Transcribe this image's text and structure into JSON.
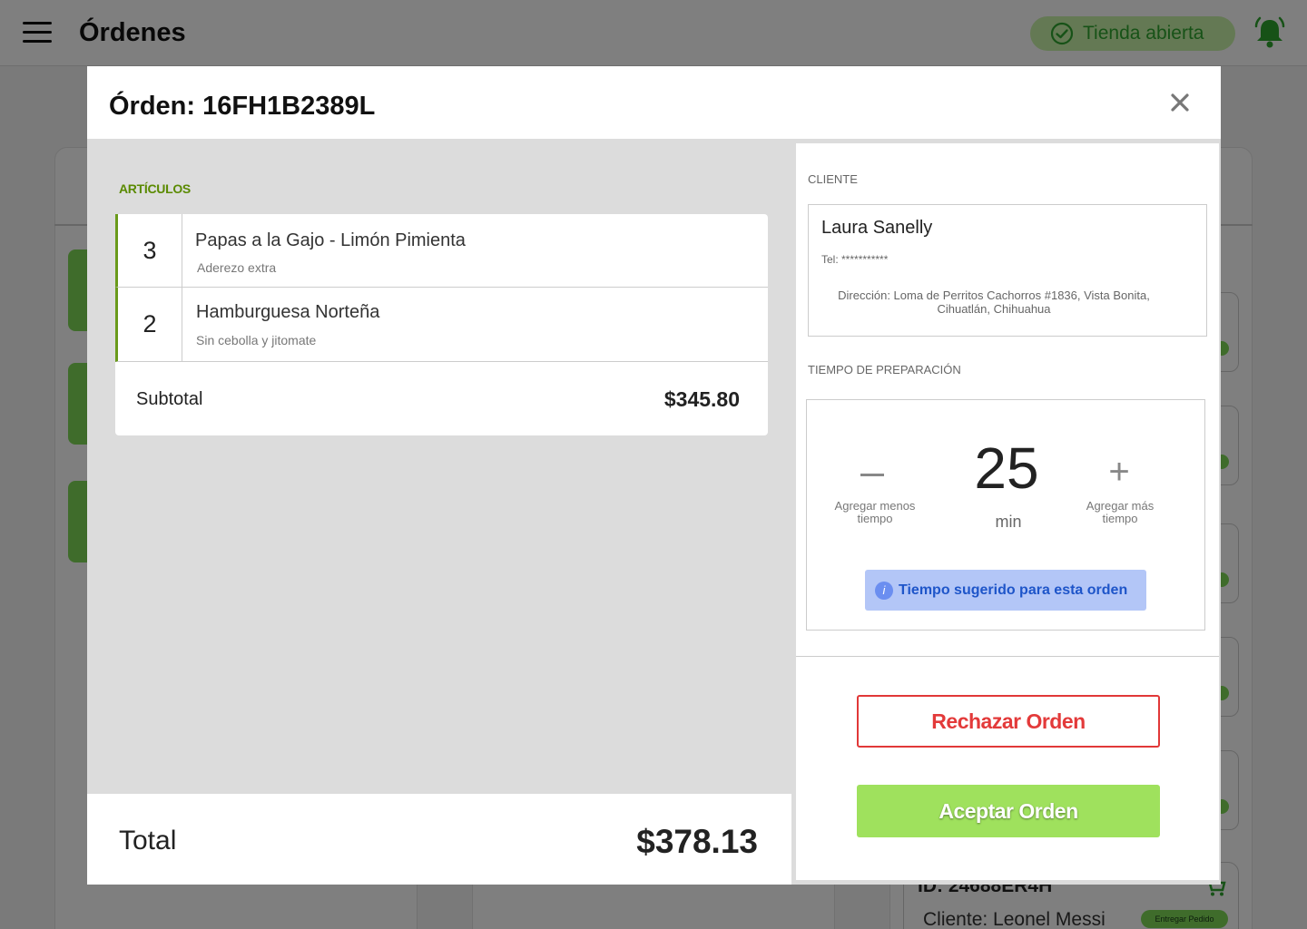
{
  "app": {
    "page_title": "Órdenes",
    "store_status": "Tienda abierta",
    "background_order": {
      "id_label": "ID: 24688ER4H",
      "client_label": "Cliente: Leonel Messi",
      "badge": "Entregar Pedido"
    }
  },
  "modal": {
    "title": "Órden: 16FH1B2389L",
    "items_section_label": "ARTÍCULOS",
    "items": [
      {
        "qty": "3",
        "name": "Papas a la Gajo - Limón Pimienta",
        "note": "Aderezo extra"
      },
      {
        "qty": "2",
        "name": "Hamburguesa Norteña",
        "note": "Sin cebolla y jitomate"
      }
    ],
    "subtotal_label": "Subtotal",
    "subtotal_value": "$345.80",
    "total_label": "Total",
    "total_value": "$378.13",
    "client_section_label": "CLIENTE",
    "client": {
      "name": "Laura Sanelly",
      "tel": "Tel: ***********",
      "address": "Dirección: Loma de Perritos Cachorros #1836, Vista Bonita, Cihuatlán, Chihuahua"
    },
    "prep_section_label": "TIEMPO DE PREPARACIÓN",
    "prep": {
      "value": "25",
      "unit": "min",
      "less_hint": "Agregar menos tiempo",
      "more_hint": "Agregar más tiempo",
      "suggestion": "Tiempo sugerido para esta orden"
    },
    "reject_label": "Rechazar Orden",
    "accept_label": "Aceptar Orden"
  },
  "colors": {
    "brand_green": "#9fe15d",
    "reject_red": "#e13838",
    "info_blue": "#1e55c9"
  }
}
